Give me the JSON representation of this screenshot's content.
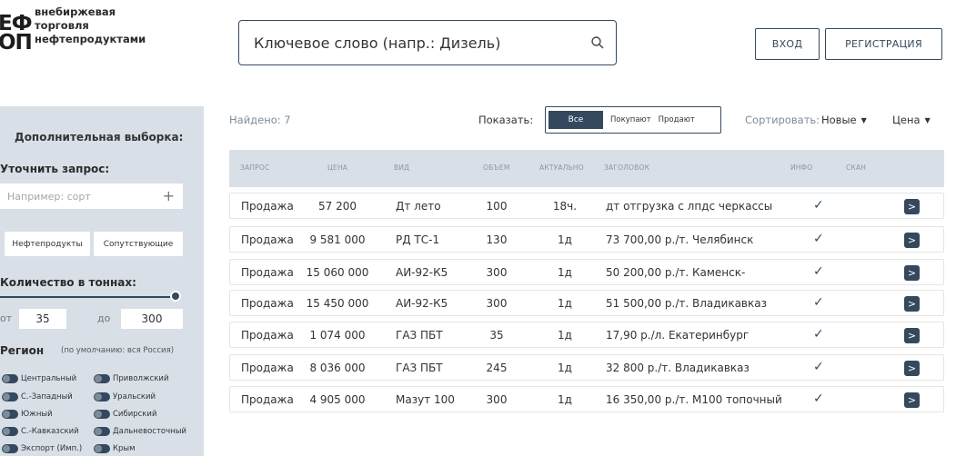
{
  "logo": {
    "mark_top": "ЕФ",
    "mark_bottom": "ОП",
    "line1": "внебиржевая",
    "line2": "торговля",
    "line3": "нефтепродуктами"
  },
  "search": {
    "placeholder": "Ключевое слово (напр.: Дизель)",
    "icon": "search-icon"
  },
  "header": {
    "login": "ВХОД",
    "register": "РЕГИСТРАЦИЯ"
  },
  "sidebar": {
    "title": "Дополнительная выборка:",
    "refine_label": "Уточнить запрос:",
    "refine_placeholder": "Например: сорт",
    "add_symbol": "+",
    "chips": [
      "Нефтепродукты",
      "Сопутствующие"
    ],
    "quantity_label": "Количество в тоннах:",
    "from_label": "от",
    "from_value": "35",
    "to_label": "до",
    "to_value": "300",
    "region_label": "Регион",
    "region_note": "(по умолчанию: вся Россия)",
    "regions": [
      "Центральный",
      "Приволжский",
      "С.-Западный",
      "Уральский",
      "Южный",
      "Сибирский",
      "С.-Кавказский",
      "Дальневосточный",
      "Экспорт (Имп.)",
      "Крым"
    ]
  },
  "toolbar": {
    "found": "Найдено: 7",
    "show_label": "Показать:",
    "filters": [
      "Все",
      "Покупают",
      "Продают"
    ],
    "active_filter": "Все",
    "sort_label": "Сортировать:",
    "sort_options": [
      "Новые",
      "Цена"
    ]
  },
  "table": {
    "headers": [
      "ЗАПРОС",
      "ЦЕНА",
      "ВИД",
      "ОБЪЕМ",
      "АКТУАЛЬНО",
      "ЗАГОЛОВОК",
      "ИНФО",
      "СКАН"
    ],
    "rows": [
      {
        "type": "Продажа",
        "price": "57 200",
        "kind": "Дт лето",
        "volume": "100",
        "actual": "18ч.",
        "title": "дт отгрузка с лпдс черкассы",
        "info": "✓"
      },
      {
        "type": "Продажа",
        "price": "9 581 000",
        "kind": "РД ТС-1",
        "volume": "130",
        "actual": "1д",
        "title": "73 700,00 р./т. Челябинск",
        "info": "✓"
      },
      {
        "type": "Продажа",
        "price": "15 060 000",
        "kind": "АИ-92-К5",
        "volume": "300",
        "actual": "1д",
        "title": "50 200,00 р./т. Каменск-",
        "info": "✓"
      },
      {
        "type": "Продажа",
        "price": "15 450 000",
        "kind": "АИ-92-К5",
        "volume": "300",
        "actual": "1д",
        "title": "51 500,00 р./т. Владикавказ",
        "info": "✓"
      },
      {
        "type": "Продажа",
        "price": "1 074 000",
        "kind": "ГАЗ ПБТ",
        "volume": "35",
        "actual": "1д",
        "title": "17,90 р./л. Екатеринбург",
        "info": "✓"
      },
      {
        "type": "Продажа",
        "price": "8 036 000",
        "kind": "ГАЗ ПБТ",
        "volume": "245",
        "actual": "1д",
        "title": "32 800 р./т. Владикавказ",
        "info": "✓"
      },
      {
        "type": "Продажа",
        "price": "4 905 000",
        "kind": "Мазут 100",
        "volume": "300",
        "actual": "1д",
        "title": "16 350,00 р./т. М100 топочный",
        "info": "✓"
      }
    ],
    "row_action": ">"
  },
  "colors": {
    "primary": "#34495e",
    "panel": "#d9dfe6",
    "muted": "#7f8c9a"
  }
}
